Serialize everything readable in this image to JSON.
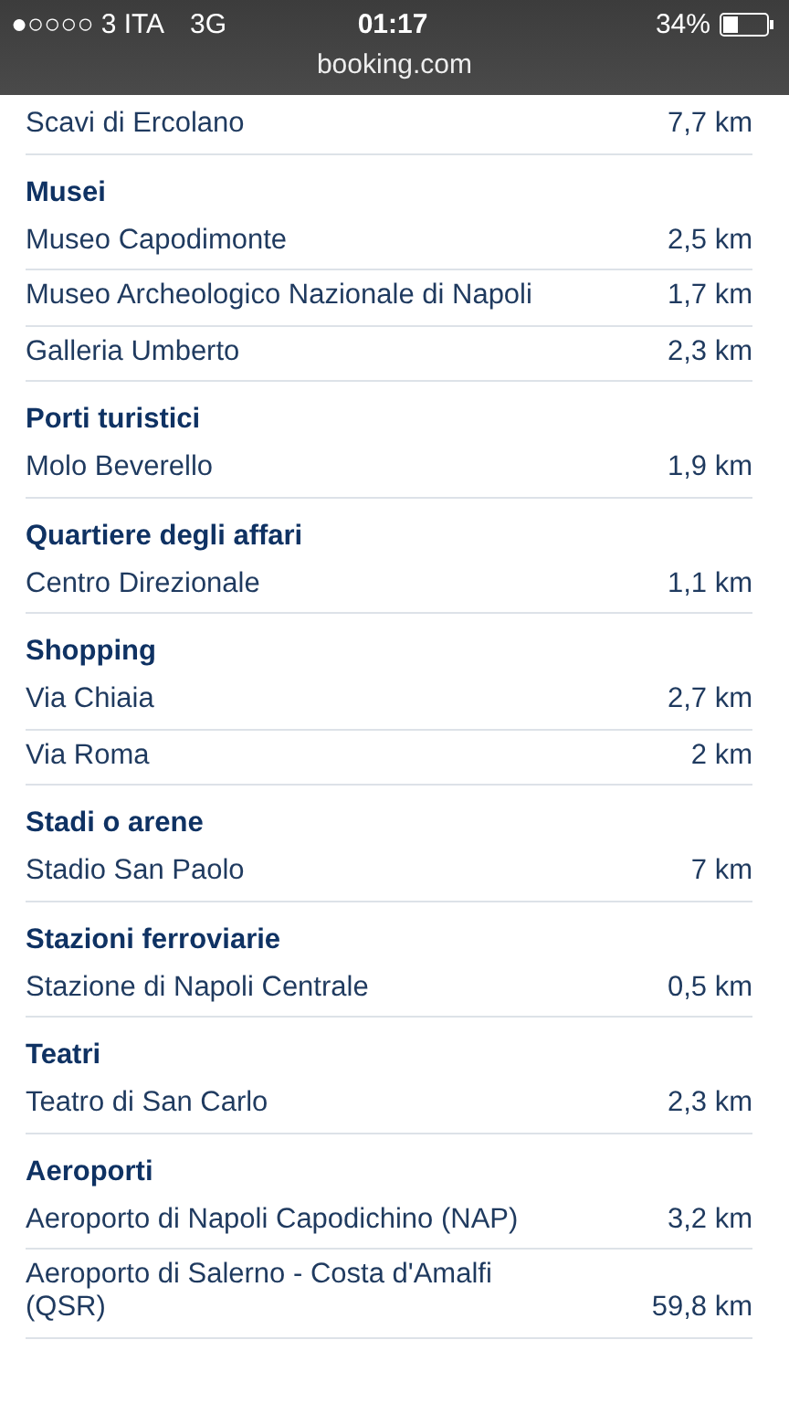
{
  "status_bar": {
    "signal": "●○○○○",
    "carrier": "3 ITA",
    "network": "3G",
    "time": "01:17",
    "battery": "34%"
  },
  "url": "booking.com",
  "sections": [
    {
      "places": [
        {
          "name": "Scavi di Ercolano",
          "distance": "7,7 km"
        }
      ]
    },
    {
      "heading": "Musei",
      "places": [
        {
          "name": "Museo Capodimonte",
          "distance": "2,5 km"
        },
        {
          "name": "Museo Archeologico Nazionale di Napoli",
          "distance": "1,7 km"
        },
        {
          "name": "Galleria Umberto",
          "distance": "2,3 km"
        }
      ]
    },
    {
      "heading": "Porti turistici",
      "places": [
        {
          "name": "Molo Beverello",
          "distance": "1,9 km"
        }
      ]
    },
    {
      "heading": "Quartiere degli affari",
      "places": [
        {
          "name": "Centro Direzionale",
          "distance": "1,1 km"
        }
      ]
    },
    {
      "heading": "Shopping",
      "places": [
        {
          "name": "Via Chiaia",
          "distance": "2,7 km"
        },
        {
          "name": "Via Roma",
          "distance": "2 km"
        }
      ]
    },
    {
      "heading": "Stadi o arene",
      "places": [
        {
          "name": "Stadio San Paolo",
          "distance": "7 km"
        }
      ]
    },
    {
      "heading": "Stazioni ferroviarie",
      "places": [
        {
          "name": "Stazione di Napoli Centrale",
          "distance": "0,5 km"
        }
      ]
    },
    {
      "heading": "Teatri",
      "places": [
        {
          "name": "Teatro di San Carlo",
          "distance": "2,3 km"
        }
      ]
    },
    {
      "heading": "Aeroporti",
      "places": [
        {
          "name": "Aeroporto di Napoli Capodichino (NAP)",
          "distance": "3,2 km"
        },
        {
          "name": "Aeroporto di Salerno - Costa d'Amalfi (QSR)",
          "distance": "59,8 km"
        }
      ]
    }
  ]
}
